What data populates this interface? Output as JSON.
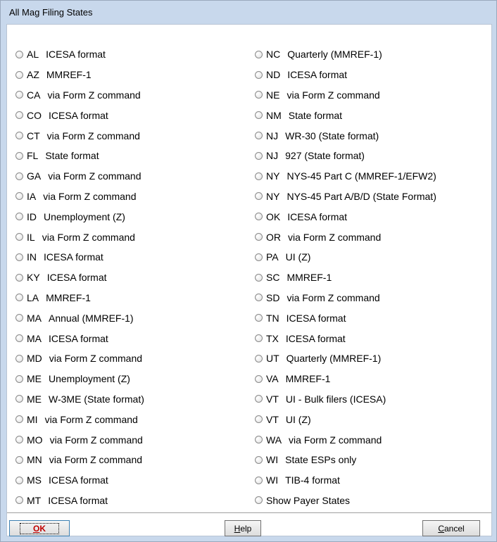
{
  "window": {
    "title": "All Mag Filing States"
  },
  "left_options": [
    {
      "state": "AL",
      "desc": "ICESA format"
    },
    {
      "state": "AZ",
      "desc": "MMREF-1"
    },
    {
      "state": "CA",
      "desc": "via Form Z command"
    },
    {
      "state": "CO",
      "desc": "ICESA format"
    },
    {
      "state": "CT",
      "desc": "via Form Z command"
    },
    {
      "state": "FL",
      "desc": "State format"
    },
    {
      "state": "GA",
      "desc": "via Form Z command"
    },
    {
      "state": "IA",
      "desc": "via Form Z command"
    },
    {
      "state": "ID",
      "desc": "Unemployment (Z)"
    },
    {
      "state": "IL",
      "desc": "via Form Z command"
    },
    {
      "state": "IN",
      "desc": "ICESA format"
    },
    {
      "state": "KY",
      "desc": "ICESA format"
    },
    {
      "state": "LA",
      "desc": "MMREF-1"
    },
    {
      "state": "MA",
      "desc": "Annual (MMREF-1)"
    },
    {
      "state": "MA",
      "desc": "ICESA format"
    },
    {
      "state": "MD",
      "desc": "via Form Z command"
    },
    {
      "state": "ME",
      "desc": "Unemployment (Z)"
    },
    {
      "state": "ME",
      "desc": "W-3ME (State format)"
    },
    {
      "state": "MI",
      "desc": "via Form Z command"
    },
    {
      "state": "MO",
      "desc": "via Form Z command"
    },
    {
      "state": "MN",
      "desc": "via Form Z command"
    },
    {
      "state": "MS",
      "desc": "ICESA format"
    },
    {
      "state": "MT",
      "desc": "ICESA format"
    }
  ],
  "right_options": [
    {
      "state": "NC",
      "desc": "Quarterly (MMREF-1)"
    },
    {
      "state": "ND",
      "desc": "ICESA format"
    },
    {
      "state": "NE",
      "desc": "via Form Z command"
    },
    {
      "state": "NM",
      "desc": "State format"
    },
    {
      "state": "NJ",
      "desc": "WR-30 (State format)"
    },
    {
      "state": "NJ",
      "desc": "927 (State format)"
    },
    {
      "state": "NY",
      "desc": "NYS-45 Part C (MMREF-1/EFW2)"
    },
    {
      "state": "NY",
      "desc": "NYS-45 Part A/B/D (State Format)"
    },
    {
      "state": "OK",
      "desc": "ICESA format"
    },
    {
      "state": "OR",
      "desc": "via Form Z command"
    },
    {
      "state": "PA",
      "desc": "UI (Z)"
    },
    {
      "state": "SC",
      "desc": "MMREF-1"
    },
    {
      "state": "SD",
      "desc": "via Form Z command"
    },
    {
      "state": "TN",
      "desc": "ICESA format"
    },
    {
      "state": "TX",
      "desc": "ICESA format"
    },
    {
      "state": "UT",
      "desc": "Quarterly (MMREF-1)"
    },
    {
      "state": "VA",
      "desc": "MMREF-1"
    },
    {
      "state": "VT",
      "desc": "UI - Bulk filers (ICESA)"
    },
    {
      "state": "VT",
      "desc": "UI (Z)"
    },
    {
      "state": "WA",
      "desc": "via Form Z command"
    },
    {
      "state": "WI",
      "desc": "State ESPs only"
    },
    {
      "state": "WI",
      "desc": "TIB-4 format"
    },
    {
      "state": "",
      "desc": "Show Payer States"
    }
  ],
  "buttons": {
    "ok": {
      "accel": "O",
      "rest": "K"
    },
    "help": {
      "accel": "H",
      "rest": "elp"
    },
    "cancel": {
      "accel": "C",
      "rest": "ancel"
    }
  }
}
